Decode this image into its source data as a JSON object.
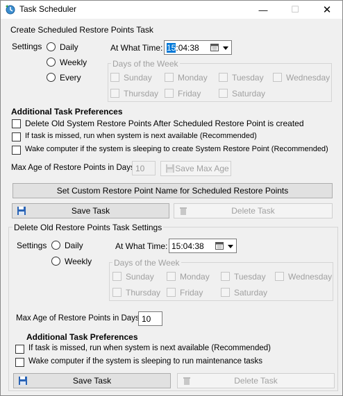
{
  "window": {
    "title": "Task Scheduler",
    "minimize": "—",
    "maximize": "☐",
    "close": "✕"
  },
  "create": {
    "heading": "Create Scheduled Restore Points Task",
    "settings_label": "Settings",
    "frequency_options": [
      "Daily",
      "Weekly",
      "Every"
    ],
    "at_time_label": "At What Time:",
    "time_selected": "15",
    "time_rest": ":04:38",
    "days_caption": "Days of the Week",
    "days": [
      "Sunday",
      "Monday",
      "Tuesday",
      "Wednesday",
      "Thursday",
      "Friday",
      "Saturday"
    ],
    "prefs_heading": "Additional Task Preferences",
    "prefs": [
      "Delete Old System Restore Points After Scheduled Restore Point is created",
      "If task is missed, run when system is next available (Recommended)",
      "Wake computer if the system is sleeping to create System Restore Point (Recommended)"
    ],
    "max_age_label": "Max Age of Restore Points in Days:",
    "max_age_value": "10",
    "save_max_age": "Save Max Age",
    "custom_name_button": "Set Custom Restore Point Name for Scheduled Restore Points",
    "save_task": "Save Task",
    "delete_task": "Delete Task"
  },
  "delete_old": {
    "caption": "Delete Old Restore Points Task Settings",
    "settings_label": "Settings",
    "frequency_options": [
      "Daily",
      "Weekly"
    ],
    "at_time_label": "At What Time:",
    "time_value": "15:04:38",
    "days_caption": "Days of the Week",
    "days": [
      "Sunday",
      "Monday",
      "Tuesday",
      "Wednesday",
      "Thursday",
      "Friday",
      "Saturday"
    ],
    "max_age_label": "Max Age of Restore Points in Days:",
    "max_age_value": "10",
    "prefs_heading": "Additional Task Preferences",
    "prefs": [
      "If task is missed, run when system is next available (Recommended)",
      "Wake computer if the system is sleeping to run maintenance tasks"
    ],
    "save_task": "Save Task",
    "delete_task": "Delete Task"
  },
  "colors": {
    "selection": "#0078d7",
    "disabled_text": "#a0a0a0",
    "window_bg": "#f0f0f0"
  },
  "icons": {
    "app": "restore-clock-icon",
    "save": "floppy-disk-icon",
    "delete": "trash-can-icon",
    "calendar": "calendar-icon"
  }
}
